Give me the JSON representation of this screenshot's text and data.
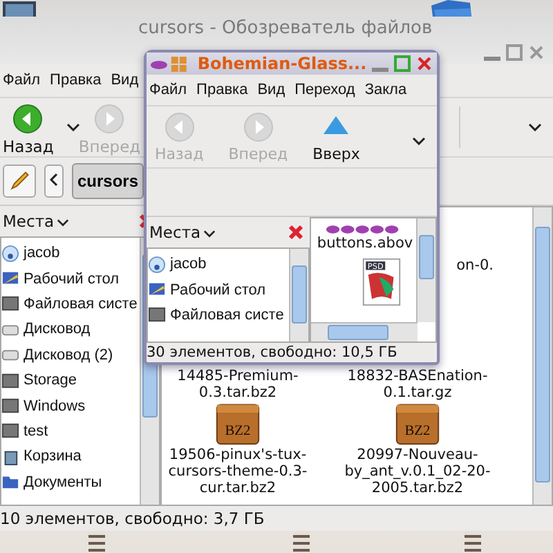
{
  "main_window": {
    "title": "cursors - Обозреватель файлов",
    "menu": [
      "Файл",
      "Правка",
      "Вид"
    ],
    "toolbar": [
      {
        "label": "Назад",
        "kind": "back",
        "disabled": false
      },
      {
        "label": "Вперед",
        "kind": "forward",
        "disabled": true
      }
    ],
    "path_button": "cursors",
    "sidebar": {
      "title": "Места",
      "items": [
        {
          "label": "jacob",
          "kind": "home"
        },
        {
          "label": "Рабочий стол",
          "kind": "desktop"
        },
        {
          "label": "Файловая систе",
          "kind": "drive"
        },
        {
          "label": "Дисковод",
          "kind": "removable"
        },
        {
          "label": "Дисковод (2)",
          "kind": "removable"
        },
        {
          "label": "Storage",
          "kind": "drive"
        },
        {
          "label": "Windows",
          "kind": "drive"
        },
        {
          "label": "test",
          "kind": "drive"
        },
        {
          "label": "Корзина",
          "kind": "trash"
        },
        {
          "label": "Документы",
          "kind": "folder"
        }
      ]
    },
    "files": [
      {
        "name": "on-0.",
        "kind": "covered"
      },
      {
        "name": "14485-Premium-0.3.tar.bz2",
        "kind": "covered"
      },
      {
        "name": "18832-BASEnation-0.1.tar.gz",
        "kind": "covered"
      },
      {
        "name": "19506-pinux's-tux-cursors-theme-0.3-cur.tar.bz2",
        "kind": "archive",
        "badge": "BZ2"
      },
      {
        "name": "20997-Nouveau-by_ant_v.0.1_02-20-2005.tar.bz2",
        "kind": "archive",
        "badge": "BZ2"
      }
    ],
    "status": "10 элементов, свободно: 3,7 ГБ"
  },
  "small_window": {
    "title": "Bohemian-Glass...",
    "menu": [
      "Файл",
      "Правка",
      "Вид",
      "Переход",
      "Закла"
    ],
    "toolbar": [
      {
        "label": "Назад",
        "kind": "back",
        "disabled": true
      },
      {
        "label": "Вперед",
        "kind": "forward",
        "disabled": true
      },
      {
        "label": "Вверх",
        "kind": "up",
        "disabled": false
      }
    ],
    "sidebar": {
      "title": "Места",
      "items": [
        {
          "label": "jacob",
          "kind": "home"
        },
        {
          "label": "Рабочий стол",
          "kind": "desktop"
        },
        {
          "label": "Файловая систе",
          "kind": "drive"
        }
      ]
    },
    "files": [
      {
        "name": "buttons.abov",
        "kind": "buttons"
      },
      {
        "kind": "psd",
        "badge": "PSD"
      }
    ],
    "status": "30 элементов, свободно: 10,5 ГБ"
  }
}
